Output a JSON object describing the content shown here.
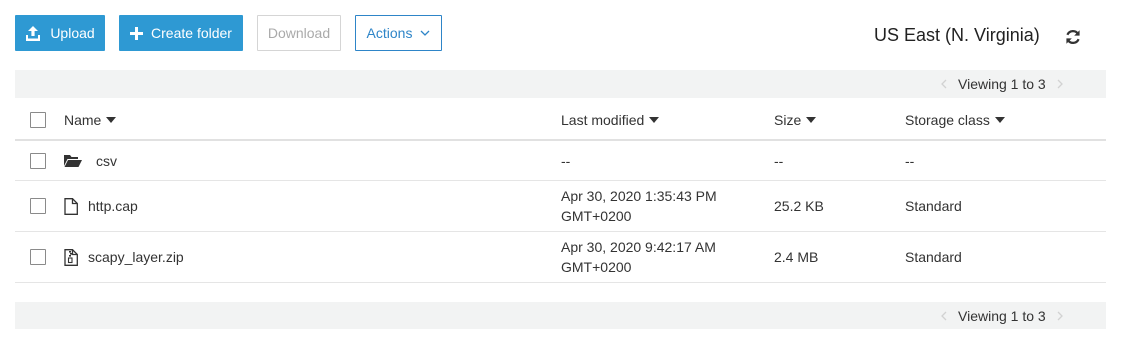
{
  "toolbar": {
    "upload_label": "Upload",
    "create_folder_label": "Create folder",
    "download_label": "Download",
    "actions_label": "Actions"
  },
  "region": {
    "label": "US East (N. Virginia)"
  },
  "pagination": {
    "top_text": "Viewing 1 to 3",
    "bottom_text": "Viewing 1 to 3"
  },
  "table": {
    "headers": {
      "name": "Name",
      "last_modified": "Last modified",
      "size": "Size",
      "storage_class": "Storage class"
    },
    "rows": [
      {
        "type": "folder",
        "icon": "folder-open-icon",
        "name": "csv",
        "last_modified_date": "--",
        "last_modified_tz": "",
        "size": "--",
        "storage_class": "--"
      },
      {
        "type": "file",
        "icon": "file-icon",
        "name": "http.cap",
        "last_modified_date": "Apr 30, 2020 1:35:43 PM",
        "last_modified_tz": "GMT+0200",
        "size": "25.2 KB",
        "storage_class": "Standard"
      },
      {
        "type": "file",
        "icon": "zip-file-icon",
        "name": "scapy_layer.zip",
        "last_modified_date": "Apr 30, 2020 9:42:17 AM",
        "last_modified_tz": "GMT+0200",
        "size": "2.4 MB",
        "storage_class": "Standard"
      }
    ]
  },
  "colors": {
    "primary": "#2e99d3",
    "actions_border": "#2e85c8",
    "pagebar_bg": "#f2f3f3"
  }
}
